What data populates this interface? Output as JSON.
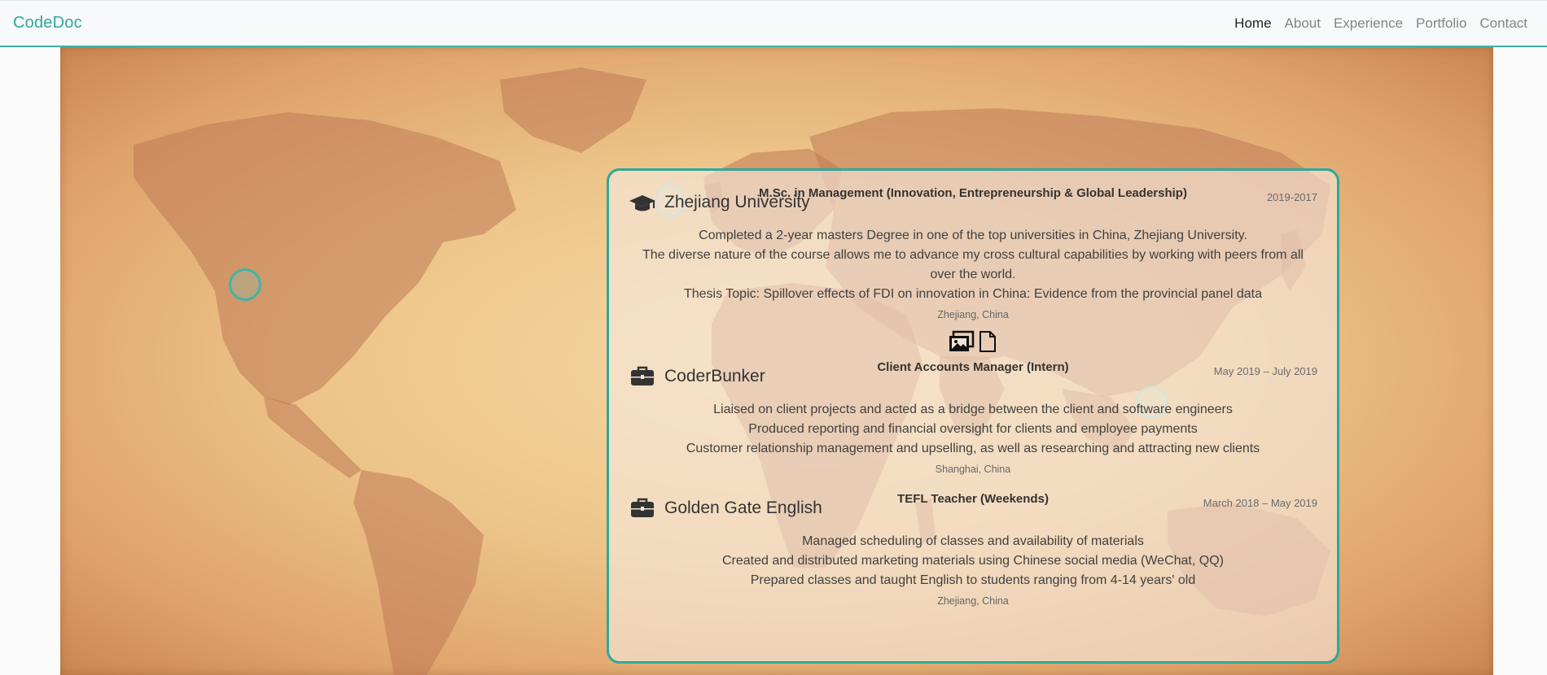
{
  "nav": {
    "brand": "CodeDoc",
    "links": [
      {
        "label": "Home",
        "active": true
      },
      {
        "label": "About",
        "active": false
      },
      {
        "label": "Experience",
        "active": false
      },
      {
        "label": "Portfolio",
        "active": false
      },
      {
        "label": "Contact",
        "active": false
      }
    ]
  },
  "colors": {
    "accent": "#2fa89a",
    "nav_bg": "#f8f9fa",
    "map_parchment": "#edc58a"
  },
  "entries": [
    {
      "icon": "graduation-cap-icon",
      "title": "Zhejiang University",
      "role": "M.Sc. in Management (Innovation, Entrepreneurship & Global Leadership)",
      "date": "2019-2017",
      "lines": [
        "Completed a 2-year masters Degree in one of the top universities in China, Zhejiang University.",
        "The diverse nature of the course allows me to advance my cross cultural capabilities by working with peers from all over the world.",
        "Thesis Topic: Spillover effects of FDI on innovation in China: Evidence from the provincial panel data"
      ],
      "location": "Zhejiang, China",
      "links": [
        "images-icon",
        "file-icon"
      ]
    },
    {
      "icon": "briefcase-icon",
      "title": "CoderBunker",
      "role": "Client Accounts Manager (Intern)",
      "date": "May 2019 – July 2019",
      "lines": [
        "Liaised on client projects and acted as a bridge between the client and software engineers",
        "Produced reporting and financial oversight for clients and employee payments",
        "Customer relationship management and upselling, as well as researching and attracting new clients"
      ],
      "location": "Shanghai, China"
    },
    {
      "icon": "briefcase-icon",
      "title": "Golden Gate English",
      "role": "TEFL Teacher (Weekends)",
      "date": "March 2018 – May 2019",
      "lines": [
        "Managed scheduling of classes and availability of materials",
        "Created and distributed marketing materials using Chinese social media (WeChat, QQ)",
        "Prepared classes and taught English to students ranging from 4-14 years' old"
      ],
      "location": "Zhejiang, China"
    }
  ]
}
